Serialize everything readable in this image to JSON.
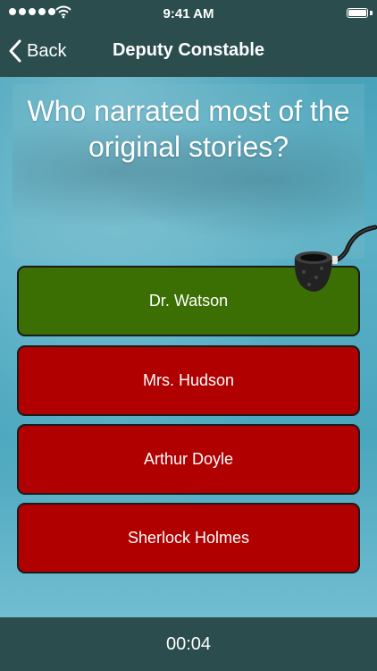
{
  "status_bar": {
    "time": "9:41 AM"
  },
  "nav": {
    "back_label": "Back",
    "title": "Deputy Constable"
  },
  "question": {
    "text": "Who narrated most of the original stories?"
  },
  "answers": [
    {
      "label": "Dr. Watson",
      "state": "correct"
    },
    {
      "label": "Mrs. Hudson",
      "state": "wrong"
    },
    {
      "label": "Arthur Doyle",
      "state": "wrong"
    },
    {
      "label": "Sherlock Holmes",
      "state": "wrong"
    }
  ],
  "footer": {
    "timer": "00:04"
  },
  "colors": {
    "bar": "#2b4d4d",
    "correct": "#3b6f03",
    "wrong": "#b00000",
    "background": "#4aa2b8"
  },
  "icons": [
    "signal-dots-icon",
    "wifi-icon",
    "battery-icon",
    "chevron-left-icon",
    "pipe-icon"
  ]
}
